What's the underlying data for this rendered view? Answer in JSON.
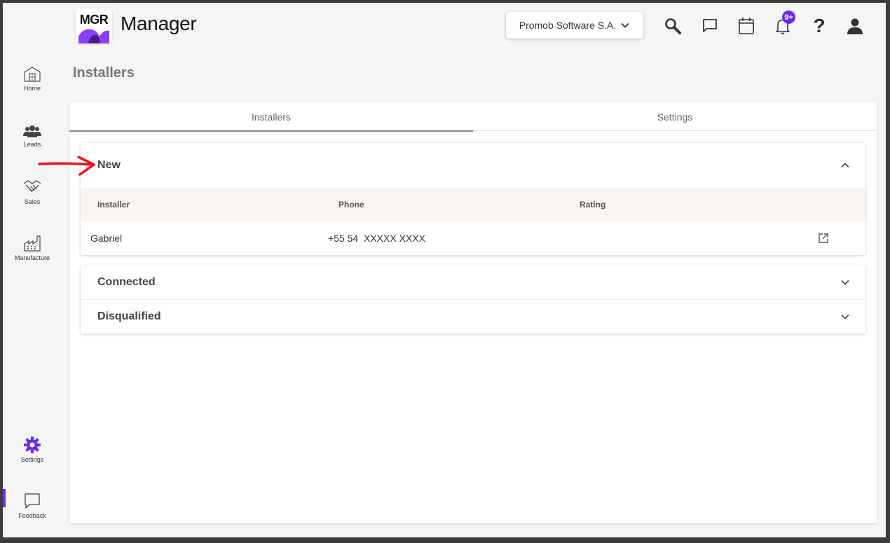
{
  "header": {
    "logo_text": "MGR",
    "app_title": "Manager",
    "company_selector": "Promob Software S.A.",
    "notifications_badge": "9+"
  },
  "sidebar": {
    "items": [
      {
        "label": "Home",
        "icon": "home-icon"
      },
      {
        "label": "Leads",
        "icon": "people-icon"
      },
      {
        "label": "Sales",
        "icon": "handshake-icon"
      },
      {
        "label": "Manufacture",
        "icon": "factory-icon"
      },
      {
        "label": "Settings",
        "icon": "gear-icon",
        "active": true
      },
      {
        "label": "Feedback",
        "icon": "feedback-icon"
      }
    ]
  },
  "page": {
    "title": "Installers",
    "tabs": [
      {
        "label": "Installers",
        "active": true
      },
      {
        "label": "Settings",
        "active": false
      }
    ]
  },
  "sections": {
    "new": {
      "title": "New",
      "expanded": true,
      "columns": [
        "Installer",
        "Phone",
        "Rating"
      ],
      "rows": [
        {
          "installer": "Gabriel",
          "phone": "+55 54  XXXXX XXXX",
          "rating": ""
        }
      ]
    },
    "connected": {
      "title": "Connected",
      "expanded": false
    },
    "disqualified": {
      "title": "Disqualified",
      "expanded": false
    }
  },
  "colors": {
    "accent": "#6b2bf0",
    "annotation_arrow": "#e8141c",
    "table_header_bg": "#f7f4f2"
  }
}
